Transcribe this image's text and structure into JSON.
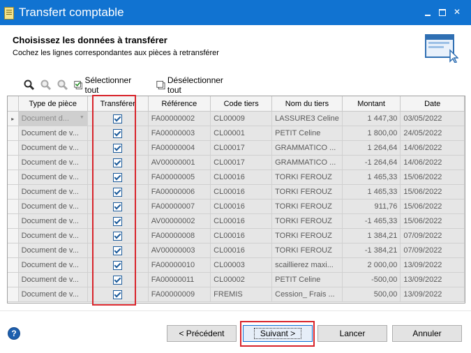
{
  "window": {
    "title": "Transfert comptable"
  },
  "header": {
    "title": "Choisissez les données à transférer",
    "subtitle": "Cochez les lignes correspondantes aux pièces à retransférer"
  },
  "toolbar": {
    "select_all": "Sélectionner tout",
    "deselect_all": "Désélectionner tout"
  },
  "columns": [
    "Type de pièce",
    "Transférer",
    "Référence",
    "Code tiers",
    "Nom du tiers",
    "Montant",
    "Date"
  ],
  "rows": [
    {
      "type": "Document d...",
      "transfer": true,
      "ref": "FA00000002",
      "code": "CL00009",
      "nom": "LASSURE3 Celine",
      "montant": "1 447,30",
      "date": "03/05/2022"
    },
    {
      "type": "Document de v...",
      "transfer": true,
      "ref": "FA00000003",
      "code": "CL00001",
      "nom": "PETIT Celine",
      "montant": "1 800,00",
      "date": "24/05/2022"
    },
    {
      "type": "Document de v...",
      "transfer": true,
      "ref": "FA00000004",
      "code": "CL00017",
      "nom": "GRAMMATICO ...",
      "montant": "1 264,64",
      "date": "14/06/2022"
    },
    {
      "type": "Document de v...",
      "transfer": true,
      "ref": "AV00000001",
      "code": "CL00017",
      "nom": "GRAMMATICO ...",
      "montant": "-1 264,64",
      "date": "14/06/2022"
    },
    {
      "type": "Document de v...",
      "transfer": true,
      "ref": "FA00000005",
      "code": "CL00016",
      "nom": "TORKI FEROUZ",
      "montant": "1 465,33",
      "date": "15/06/2022"
    },
    {
      "type": "Document de v...",
      "transfer": true,
      "ref": "FA00000006",
      "code": "CL00016",
      "nom": "TORKI FEROUZ",
      "montant": "1 465,33",
      "date": "15/06/2022"
    },
    {
      "type": "Document de v...",
      "transfer": true,
      "ref": "FA00000007",
      "code": "CL00016",
      "nom": "TORKI FEROUZ",
      "montant": "911,76",
      "date": "15/06/2022"
    },
    {
      "type": "Document de v...",
      "transfer": true,
      "ref": "AV00000002",
      "code": "CL00016",
      "nom": "TORKI FEROUZ",
      "montant": "-1 465,33",
      "date": "15/06/2022"
    },
    {
      "type": "Document de v...",
      "transfer": true,
      "ref": "FA00000008",
      "code": "CL00016",
      "nom": "TORKI FEROUZ",
      "montant": "1 384,21",
      "date": "07/09/2022"
    },
    {
      "type": "Document de v...",
      "transfer": true,
      "ref": "AV00000003",
      "code": "CL00016",
      "nom": "TORKI FEROUZ",
      "montant": "-1 384,21",
      "date": "07/09/2022"
    },
    {
      "type": "Document de v...",
      "transfer": true,
      "ref": "FA00000010",
      "code": "CL00003",
      "nom": "scaillierez maxi...",
      "montant": "2 000,00",
      "date": "13/09/2022"
    },
    {
      "type": "Document de v...",
      "transfer": true,
      "ref": "FA00000011",
      "code": "CL00002",
      "nom": "PETIT Celine",
      "montant": "-500,00",
      "date": "13/09/2022"
    },
    {
      "type": "Document de v...",
      "transfer": true,
      "ref": "FA00000009",
      "code": "FREMIS",
      "nom": "Cession_ Frais ...",
      "montant": "500,00",
      "date": "13/09/2022"
    }
  ],
  "buttons": {
    "previous": "< Précédent",
    "next": "Suivant >",
    "launch": "Lancer",
    "cancel": "Annuler"
  },
  "help_label": "?",
  "colors": {
    "titlebar": "#1173d1",
    "highlight": "#d8232a"
  }
}
